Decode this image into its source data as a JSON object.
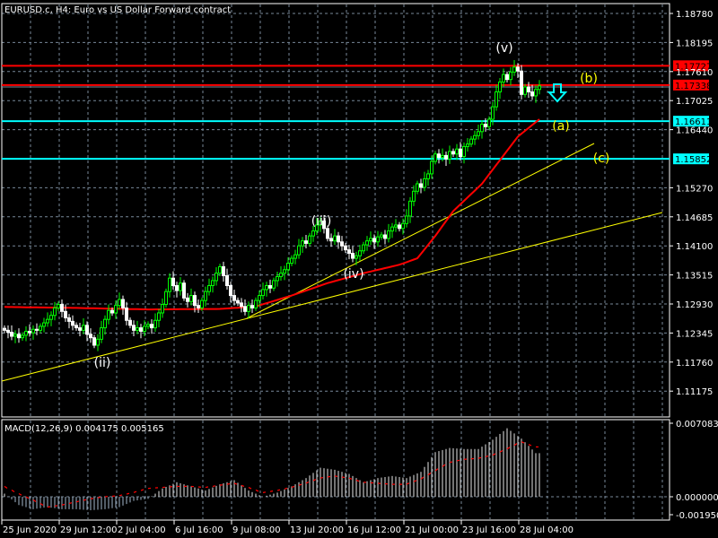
{
  "title": "EURUSD.c, H4:  Euro vs US Dollar Forward contract",
  "colors": {
    "background": "#000000",
    "grid": "#778899",
    "bull": "#00ff00",
    "bear": "#ffffff",
    "ma": "#ff0000",
    "resistance": "#ff0000",
    "support": "#00ffff",
    "trendline": "#ffff00",
    "macd": "#c0c0c0",
    "signal": "#ff0000"
  },
  "chart_data": [
    {
      "type": "candlestick",
      "title": "EURUSD.c, H4:  Euro vs US Dollar Forward contract",
      "ylim": [
        1.107,
        1.1925
      ],
      "grid": true,
      "y_ticks": [
        "1.18780",
        "1.18195",
        "1.17610",
        "1.17025",
        "1.16440",
        "1.15270",
        "1.14685",
        "1.14100",
        "1.13515",
        "1.12930",
        "1.12345",
        "1.11760",
        "1.11175"
      ],
      "x_ticks": [
        "25 Jun 2020",
        "29 Jun 12:00",
        "2 Jul 04:00",
        "6 Jul 16:00",
        "9 Jul 08:00",
        "13 Jul 20:00",
        "16 Jul 12:00",
        "21 Jul 00:00",
        "23 Jul 16:00",
        "28 Jul 04:00"
      ],
      "closes": [
        1.124,
        1.1236,
        1.1228,
        1.1232,
        1.1225,
        1.123,
        1.1238,
        1.1235,
        1.1242,
        1.124,
        1.1248,
        1.1255,
        1.1262,
        1.127,
        1.1285,
        1.1292,
        1.1278,
        1.1265,
        1.1258,
        1.125,
        1.1245,
        1.124,
        1.125,
        1.1232,
        1.1225,
        1.121,
        1.1222,
        1.1245,
        1.1262,
        1.128,
        1.1275,
        1.129,
        1.1302,
        1.1285,
        1.126,
        1.125,
        1.124,
        1.1245,
        1.1238,
        1.1248,
        1.1252,
        1.1245,
        1.126,
        1.1275,
        1.1292,
        1.1318,
        1.1345,
        1.133,
        1.132,
        1.1335,
        1.1305,
        1.1298,
        1.131,
        1.129,
        1.1285,
        1.13,
        1.1318,
        1.133,
        1.134,
        1.1355,
        1.1368,
        1.135,
        1.133,
        1.131,
        1.13,
        1.1295,
        1.1288,
        1.1278,
        1.129,
        1.1285,
        1.13,
        1.131,
        1.1322,
        1.133,
        1.1325,
        1.134,
        1.1348,
        1.1355,
        1.1362,
        1.1375,
        1.1385,
        1.1392,
        1.141,
        1.142,
        1.1415,
        1.143,
        1.144,
        1.1452,
        1.146,
        1.1445,
        1.1425,
        1.142,
        1.143,
        1.1418,
        1.141,
        1.1402,
        1.1395,
        1.1385,
        1.139,
        1.14,
        1.1412,
        1.142,
        1.1425,
        1.1418,
        1.1428,
        1.1432,
        1.1425,
        1.144,
        1.1448,
        1.1452,
        1.1445,
        1.1455,
        1.147,
        1.15,
        1.152,
        1.1535,
        1.1528,
        1.1545,
        1.1555,
        1.158,
        1.1595,
        1.1588,
        1.1592,
        1.1585,
        1.16,
        1.1595,
        1.1605,
        1.159,
        1.161,
        1.1615,
        1.1625,
        1.1632,
        1.164,
        1.1655,
        1.165,
        1.1665,
        1.169,
        1.172,
        1.174,
        1.1755,
        1.1745,
        1.176,
        1.177,
        1.1762,
        1.1715,
        1.173,
        1.172,
        1.1712,
        1.1725,
        1.1732
      ],
      "moving_average": [
        [
          0,
          1.1287
        ],
        [
          20,
          1.1285
        ],
        [
          40,
          1.1282
        ],
        [
          60,
          1.1283
        ],
        [
          70,
          1.1288
        ],
        [
          80,
          1.131
        ],
        [
          90,
          1.1335
        ],
        [
          100,
          1.1355
        ],
        [
          110,
          1.1372
        ],
        [
          115,
          1.1385
        ],
        [
          120,
          1.143
        ],
        [
          125,
          1.148
        ],
        [
          133,
          1.1535
        ],
        [
          143,
          1.163
        ],
        [
          149,
          1.1665
        ]
      ],
      "levels": [
        {
          "price": "1.17727",
          "kind": "resistance"
        },
        {
          "price": "1.17338",
          "kind": "resistance"
        },
        {
          "price": "1.16611",
          "kind": "support"
        },
        {
          "price": "1.15852",
          "kind": "support"
        }
      ],
      "annotations": {
        "v": "(v)",
        "iii": "(iii)",
        "iv": "(iv)",
        "ii": "(ii)",
        "a": "(a)",
        "b": "(b)",
        "c": "(c)"
      }
    },
    {
      "type": "bar",
      "title": "MACD(12,26,9) 0.004175 0.005165",
      "ylim": [
        -0.00195,
        0.007083
      ],
      "y_ticks": [
        "0.007083",
        "0.000000",
        "-0.001950"
      ],
      "macd": [
        0.0003,
        -0.0008,
        -0.0012,
        -0.001,
        -0.0012,
        -0.0012,
        -0.0013,
        -0.0012,
        -0.001,
        -0.0004,
        -0.0002,
        0.0008,
        0.0014,
        0.001,
        0.0006,
        0.0012,
        0.0016,
        0.0006,
        0.0,
        0.0004,
        0.001,
        0.0018,
        0.0028,
        0.0026,
        0.0022,
        0.0014,
        0.0018,
        0.002,
        0.0018,
        0.0024,
        0.0043,
        0.0047,
        0.0046,
        0.0046,
        0.0055,
        0.0066,
        0.0056,
        0.0042
      ],
      "signal": [
        0.001,
        0.0003,
        -0.0003,
        -0.001,
        -0.0008,
        -0.0005,
        -0.0002,
        0.0,
        0.0001,
        0.0004,
        0.0008,
        0.0009,
        0.001,
        0.001,
        0.0009,
        0.0011,
        0.0013,
        0.0009,
        0.0004,
        0.0006,
        0.0009,
        0.0013,
        0.0018,
        0.002,
        0.0018,
        0.0014,
        0.0013,
        0.0012,
        0.0012,
        0.0017,
        0.0025,
        0.0033,
        0.0036,
        0.0037,
        0.004,
        0.0046,
        0.0053,
        0.0048
      ]
    }
  ]
}
